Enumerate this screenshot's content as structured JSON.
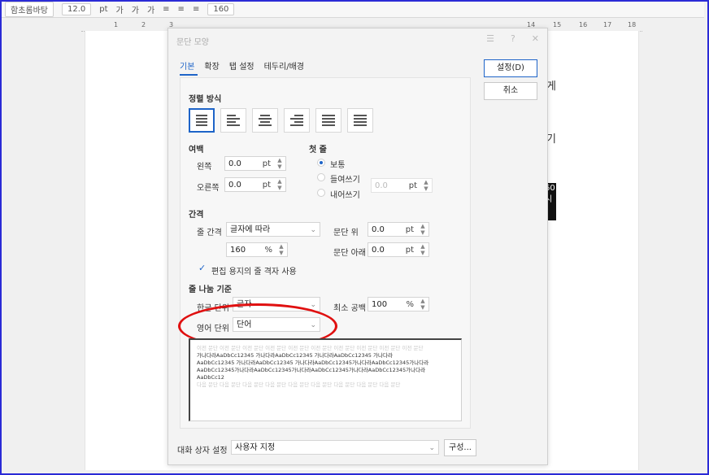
{
  "ruler": [
    "1",
    "2",
    "3",
    "14",
    "15",
    "16",
    "17",
    "18"
  ],
  "toolbar": {
    "font": "함초롬바탕",
    "size": "12.0",
    "unit": "pt",
    "zoom": "160"
  },
  "side_text": [
    "게",
    "기",
    "60",
    "시"
  ],
  "dialog": {
    "title": "문단 모양",
    "tabs": [
      "기본",
      "확장",
      "탭 설정",
      "테두리/배경"
    ],
    "ok_label": "설정(D)",
    "cancel_label": "취소",
    "align_heading": "정렬 방식",
    "margin": {
      "heading": "여백",
      "left_label": "왼쪽",
      "left_value": "0.0",
      "right_label": "오른쪽",
      "right_value": "0.0",
      "unit": "pt"
    },
    "first_line": {
      "heading": "첫 줄",
      "options": [
        "보통",
        "들여쓰기",
        "내어쓰기"
      ],
      "selected": "보통",
      "value": "0.0",
      "unit": "pt"
    },
    "spacing": {
      "heading": "간격",
      "line_label": "줄 간격",
      "line_type": "글자에 따라",
      "line_value": "160",
      "line_unit": "%",
      "above_label": "문단 위",
      "above_value": "0.0",
      "below_label": "문단 아래",
      "below_value": "0.0",
      "unit": "pt",
      "grid_check": "편집 용지의 줄 격자 사용"
    },
    "break": {
      "heading": "줄 나눔 기준",
      "hangul_label": "한글 단위",
      "hangul_value": "글자",
      "english_label": "영어 단위",
      "english_value": "단어",
      "min_space_label": "최소 공백",
      "min_space_value": "100",
      "min_space_unit": "%"
    },
    "preview": {
      "grey_line": "이전 문단 이전 문단 이전 문단 이전 문단 이전 문단 이전 문단 이전 문단 이전 문단 이전 문단 이전 문단",
      "lines": [
        "가나다라AaDbCc12345 가나다라AaDbCc12345 가나다라AaDbCc12345 가나다라",
        "AaDbCc12345 가나다라AaDbCc12345 가나다라AaDbCc12345가나다라AaDbCc12345가나다라",
        "AaDbCc12345가나다라AaDbCc12345가나다라AaDbCc12345가나다라AaDbCc12345가나다라",
        "AaDbCc12"
      ],
      "grey_after": "다음 문단 다음 문단 다음 문단 다음 문단 다음 문단 다음 문단 다음 문단 다음 문단 다음 문단"
    },
    "dialog_setting_label": "대화 상자 설정",
    "dialog_setting_value": "사용자 지정",
    "config_button": "구성..."
  }
}
